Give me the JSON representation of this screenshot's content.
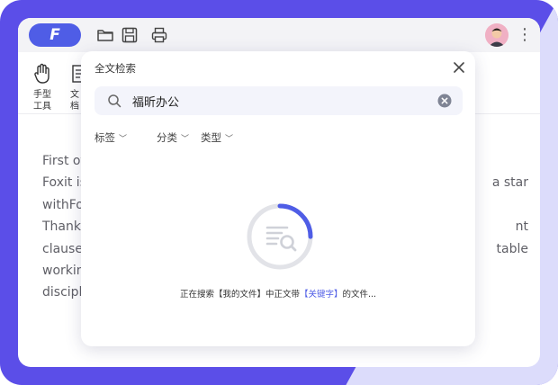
{
  "app": {
    "logo_letter": "F"
  },
  "ribbon": {
    "tools": [
      {
        "label_line1": "手型",
        "label_line2": "工具"
      },
      {
        "label_line1": "文",
        "label_line2": "档"
      }
    ]
  },
  "document": {
    "lines": [
      {
        "left": "First of",
        "right": ""
      },
      {
        "left": "Foxit is",
        "right": "a star"
      },
      {
        "left": "withFo",
        "right": ""
      },
      {
        "left": "Thank",
        "right": "nt"
      },
      {
        "left": "clauses",
        "right": "table"
      },
      {
        "left": "workin",
        "right": ""
      },
      {
        "left": "discipl",
        "right": ""
      }
    ]
  },
  "search_panel": {
    "title": "全文检索",
    "query": "福昕办公",
    "filters": [
      {
        "label": "标签"
      },
      {
        "label": "分类"
      },
      {
        "label": "类型"
      }
    ],
    "status_prefix": "正在搜索【我的文件】中正文带",
    "status_keyword": "【关键字】",
    "status_suffix": "的文件...",
    "progress_fraction": 0.25
  },
  "colors": {
    "brand": "#4f5de6",
    "frame_purple": "#5b4ee8",
    "frame_lavender": "#dcdcfb",
    "spinner_track": "#e2e3e8",
    "spinner_fill": "#4f5de6"
  }
}
